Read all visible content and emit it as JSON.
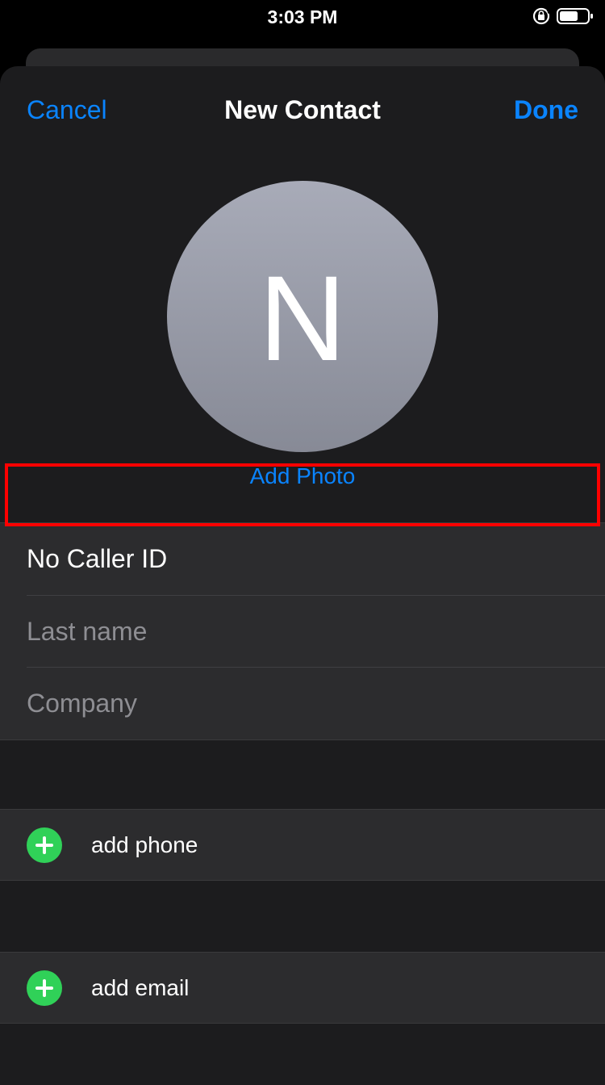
{
  "status_bar": {
    "time": "3:03 PM",
    "icons": [
      "rotation-lock-icon",
      "battery-icon"
    ]
  },
  "nav": {
    "cancel_label": "Cancel",
    "title": "New Contact",
    "done_label": "Done"
  },
  "avatar": {
    "initial": "N",
    "add_photo_label": "Add Photo"
  },
  "name_fields": {
    "first_name_value": "No Caller ID",
    "last_name_placeholder": "Last name",
    "company_placeholder": "Company"
  },
  "actions": {
    "add_phone_label": "add phone",
    "add_email_label": "add email"
  },
  "colors": {
    "accent": "#0a84ff",
    "add_green": "#30d158",
    "highlight_red": "#ff0000",
    "sheet_bg": "#1c1c1e",
    "cell_bg": "#2c2c2e"
  }
}
